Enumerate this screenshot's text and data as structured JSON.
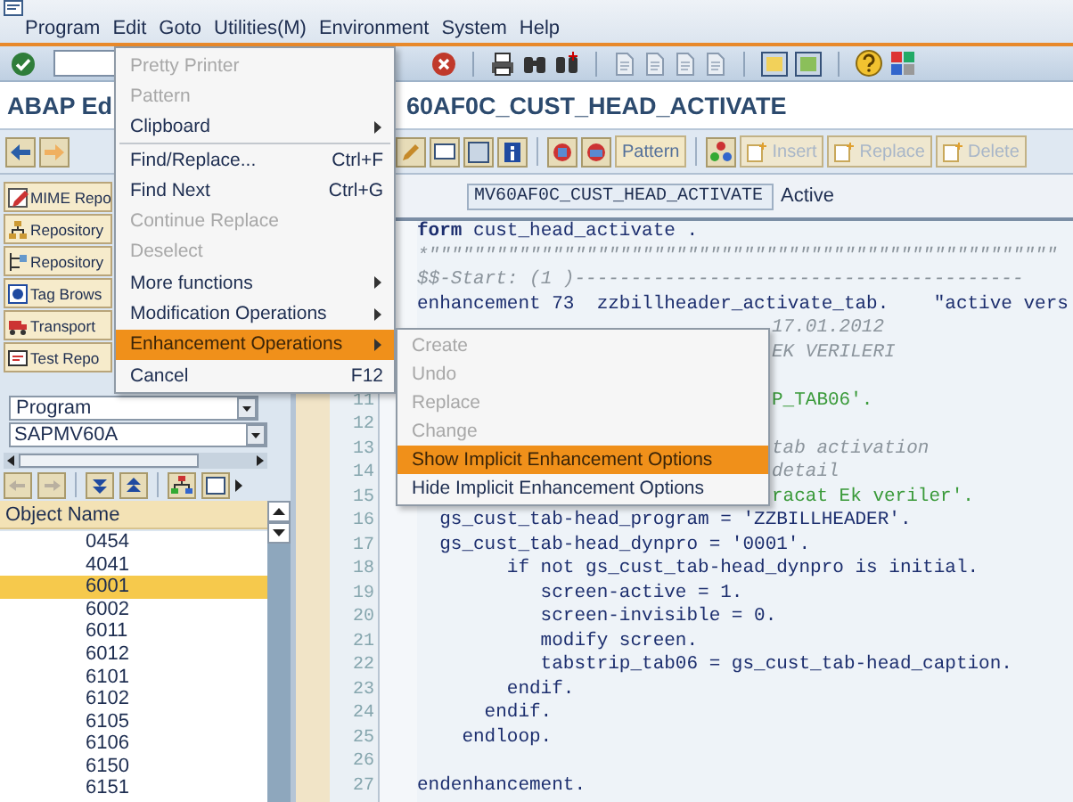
{
  "menu_bar": {
    "items": [
      "Program",
      "Edit",
      "Goto",
      "Utilities(M)",
      "Environment",
      "System",
      "Help"
    ]
  },
  "title": {
    "left": "ABAP Ed",
    "right": "60AF0C_CUST_HEAD_ACTIVATE"
  },
  "application_toolbar": {
    "buttons": [
      {
        "label": "Pattern",
        "disabled": false
      },
      {
        "label": "Insert",
        "disabled": true
      },
      {
        "label": "Replace",
        "disabled": true
      },
      {
        "label": "Delete",
        "disabled": true
      }
    ]
  },
  "navigation": {
    "buttons": [
      "MIME Repo",
      "Repository",
      "Repository",
      "Tag Brows",
      "Transport",
      "Test Repo"
    ],
    "object_type": {
      "value": "Program"
    },
    "object_name": {
      "value": "SAPMV60A"
    },
    "object_list": {
      "column": "Object Name",
      "rows": [
        {
          "name": "0454",
          "selected": false
        },
        {
          "name": "4041",
          "selected": false
        },
        {
          "name": "6001",
          "selected": true
        },
        {
          "name": "6002",
          "selected": false
        },
        {
          "name": "6011",
          "selected": false
        },
        {
          "name": "6012",
          "selected": false
        },
        {
          "name": "6101",
          "selected": false
        },
        {
          "name": "6102",
          "selected": false
        },
        {
          "name": "6105",
          "selected": false
        },
        {
          "name": "6106",
          "selected": false
        },
        {
          "name": "6150",
          "selected": false
        },
        {
          "name": "6151",
          "selected": false
        }
      ]
    }
  },
  "editor": {
    "include": "MV60AF0C_CUST_HEAD_ACTIVATE",
    "status": "Active",
    "lines": [
      {
        "kind": "code",
        "text": "**form** cust_head_activate ."
      },
      {
        "kind": "comment",
        "text": "*\"\"\"\"\"\"\"\"\"\"\"\"\"\"\"\"\"\"\"\"\"\"\"\"\"\"\"\"\"\"\"\"\"\"\"\"\"\"\"\"\"\"\"\"\"\"\"\"\"\"\"\"\"\"\"\""
      },
      {
        "kind": "comment",
        "text": "*$*$-Start: (1 )----------------------------------------"
      },
      {
        "kind": "code",
        "text": "enhancement 73  zzbillheader_activate_tab.    \"active vers"
      },
      {
        "kind": "partial_comment",
        "text": "17.01.2012"
      },
      {
        "kind": "partial_comment",
        "text": "EK VERILERI"
      },
      {
        "kind": "blank"
      },
      {
        "number": "11",
        "kind": "partial_string",
        "text": "P_TAB06'."
      },
      {
        "number": "12",
        "kind": "blank"
      },
      {
        "number": "13",
        "kind": "partial_comment",
        "text": "tab activation"
      },
      {
        "number": "14",
        "kind": "partial_comment",
        "text": "detail"
      },
      {
        "number": "15",
        "kind": "partial_string",
        "text": "racat Ek veriler'."
      },
      {
        "number": "16",
        "kind": "code",
        "text": "  gs_cust_tab-head_program = 'ZZBILLHEADER'."
      },
      {
        "number": "17",
        "kind": "code",
        "text": "  gs_cust_tab-head_dynpro = '0001'."
      },
      {
        "number": "18",
        "kind": "code",
        "text": "        if not gs_cust_tab-head_dynpro is initial."
      },
      {
        "number": "19",
        "kind": "code",
        "text": "           screen-active = 1."
      },
      {
        "number": "20",
        "kind": "code",
        "text": "           screen-invisible = 0."
      },
      {
        "number": "21",
        "kind": "code",
        "text": "           modify screen."
      },
      {
        "number": "22",
        "kind": "code",
        "text": "           tabstrip_tab06 = gs_cust_tab-head_caption."
      },
      {
        "number": "23",
        "kind": "code",
        "text": "        endif."
      },
      {
        "number": "24",
        "kind": "code",
        "text": "      endif."
      },
      {
        "number": "25",
        "kind": "code",
        "text": "    endloop."
      },
      {
        "number": "26",
        "kind": "blank"
      },
      {
        "number": "27",
        "kind": "code",
        "text": "endenhancement."
      }
    ]
  },
  "edit_menu": {
    "items": [
      {
        "label": "Pretty Printer",
        "disabled": true,
        "submenu": false,
        "selected": false
      },
      {
        "label": "Pattern",
        "disabled": true,
        "submenu": false,
        "selected": false
      },
      {
        "label": "Clipboard",
        "disabled": false,
        "submenu": true,
        "selected": false
      },
      {
        "label": "Find/Replace...",
        "shortcut": "Ctrl+F",
        "separator_before": true,
        "disabled": false,
        "submenu": false,
        "selected": false
      },
      {
        "label": "Find Next",
        "shortcut": "Ctrl+G",
        "disabled": false,
        "submenu": false,
        "selected": false
      },
      {
        "label": "Continue Replace",
        "disabled": true,
        "submenu": false,
        "selected": false
      },
      {
        "label": "Deselect",
        "disabled": true,
        "submenu": false,
        "selected": false
      },
      {
        "label": "More functions",
        "disabled": false,
        "submenu": true,
        "selected": false
      },
      {
        "label": "Modification Operations",
        "disabled": false,
        "submenu": true,
        "selected": false
      },
      {
        "label": "Enhancement Operations",
        "disabled": false,
        "submenu": true,
        "selected": true
      },
      {
        "label": "Cancel",
        "shortcut": "F12",
        "disabled": false,
        "submenu": false,
        "selected": false
      }
    ]
  },
  "submenu": {
    "items": [
      {
        "label": "Create",
        "disabled": true,
        "submenu": false,
        "selected": false
      },
      {
        "label": "Undo",
        "disabled": true,
        "submenu": false,
        "selected": false
      },
      {
        "label": "Replace",
        "disabled": true,
        "submenu": false,
        "selected": false
      },
      {
        "label": "Change",
        "disabled": true,
        "submenu": false,
        "selected": false
      },
      {
        "label": "Show Implicit Enhancement Options",
        "disabled": false,
        "submenu": false,
        "selected": true
      },
      {
        "label": "Hide Implicit Enhancement Options",
        "disabled": false,
        "submenu": false,
        "selected": false
      }
    ]
  }
}
